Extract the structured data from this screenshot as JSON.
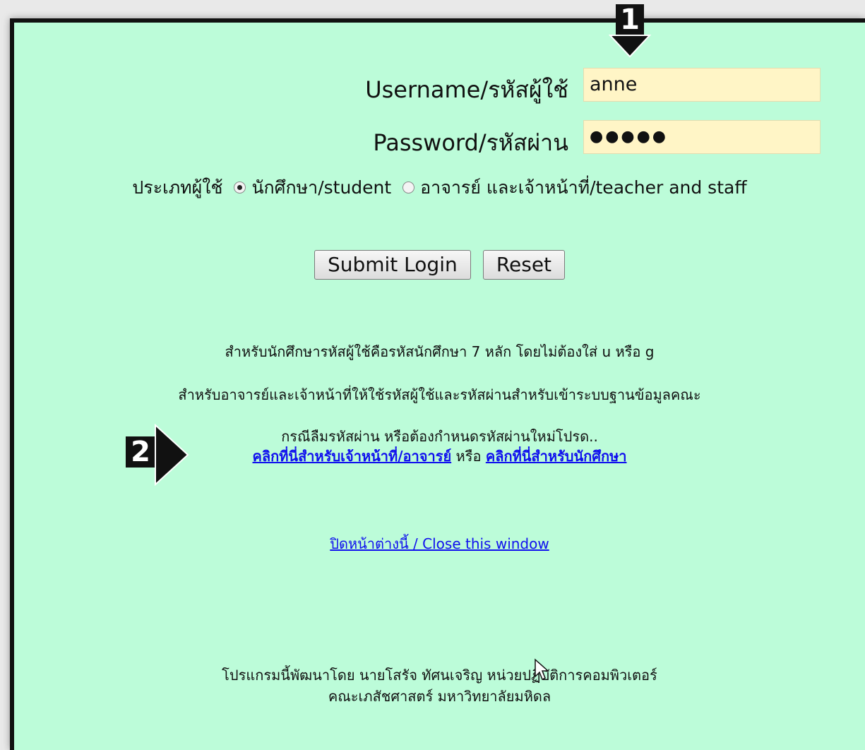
{
  "login": {
    "username_label": "Username/รหัสผู้ใช้",
    "username_value": "anne",
    "password_label": "Password/รหัสผ่าน",
    "password_value": "●●●●●"
  },
  "user_type": {
    "label": "ประเภทผู้ใช้",
    "options": [
      {
        "label": "นักศึกษา/student",
        "selected": true
      },
      {
        "label": "อาจารย์ และเจ้าหน้าที่/teacher and staff",
        "selected": false
      }
    ]
  },
  "buttons": {
    "submit": "Submit Login",
    "reset": "Reset"
  },
  "info": {
    "student_note": "สำหรับนักศึกษารหัสผู้ใช้คือรหัสนักศึกษา 7 หลัก โดยไม่ต้องใส่ u หรือ g",
    "staff_note": "สำหรับอาจารย์และเจ้าหน้าที่ให้ใช้รหัสผู้ใช้และรหัสผ่านสำหรับเข้าระบบฐานข้อมูลคณะ",
    "forgot_note": "กรณีลืมรหัสผ่าน หรือต้องกำหนดรหัสผ่านใหม่โปรด..",
    "staff_link": "คลิกที่นี่สำหรับเจ้าหน้าที่/อาจารย์",
    "or_text": "หรือ",
    "student_link": "คลิกที่นี่สำหรับนักศึกษา"
  },
  "close_link": "ปิดหน้าต่างนี้ / Close this window",
  "footer": {
    "line1": "โปรแกรมนี้พัฒนาโดย นายโสรัจ ทัศนเจริญ หน่วยปฏิบัติการคอมพิวเตอร์",
    "line2": "คณะเภสัชศาสตร์ มหาวิทยาลัยมหิดล"
  },
  "annotations": {
    "badge1": "1",
    "badge2": "2"
  },
  "colors": {
    "background": "#bcfcd9",
    "input_bg": "#fff5c6",
    "link": "#1010ee"
  }
}
